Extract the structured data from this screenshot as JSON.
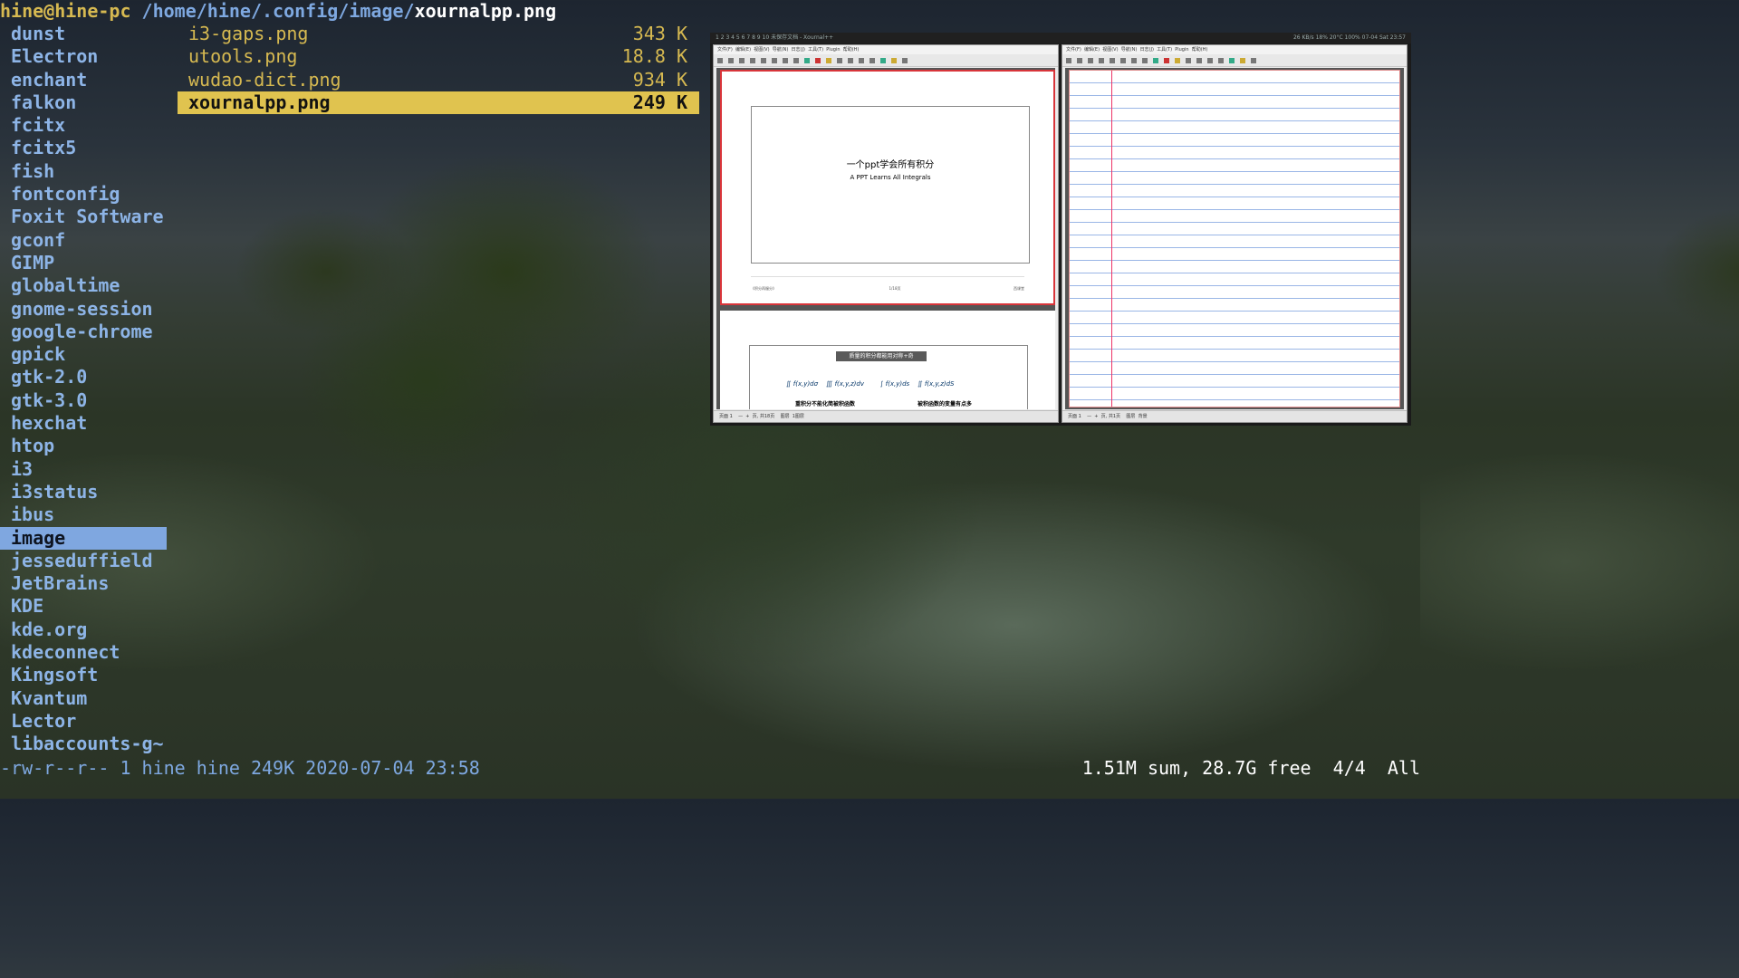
{
  "prompt": {
    "user": "hine@hine-pc",
    "path": "/home/hine/.config/image/",
    "file": "xournalpp.png"
  },
  "directories": [
    "dunst",
    "Electron",
    "enchant",
    "falkon",
    "fcitx",
    "fcitx5",
    "fish",
    "fontconfig",
    "Foxit Software",
    "gconf",
    "GIMP",
    "globaltime",
    "gnome-session",
    "google-chrome",
    "gpick",
    "gtk-2.0",
    "gtk-3.0",
    "hexchat",
    "htop",
    "i3",
    "i3status",
    "ibus",
    "image",
    "jesseduffield",
    "JetBrains",
    "KDE",
    "kde.org",
    "kdeconnect",
    "Kingsoft",
    "Kvantum",
    "Lector",
    "libaccounts-g~"
  ],
  "selected_directory": "image",
  "files": [
    {
      "name": "i3-gaps.png",
      "size": "343 K"
    },
    {
      "name": "utools.png",
      "size": "18.8 K"
    },
    {
      "name": "wudao-dict.png",
      "size": "934 K"
    },
    {
      "name": "xournalpp.png",
      "size": "249 K"
    }
  ],
  "selected_file": "xournalpp.png",
  "status": {
    "info": "-rw-r--r-- 1 hine hine 249K 2020-07-04 23:58",
    "summary": "1.51M sum, 28.7G free  4/4  All"
  },
  "preview": {
    "titlebar_left": "1 2 3 4 5 6 7 8 9 10  未保存文档 - Xournal++",
    "titlebar_right": "26 KB/s  18%  20°C  100%  07-04 Sat 23:57",
    "menu_left": "文件(F)  编辑(E)  视图(V)  导航(N)  日志(J)  工具(T)  Plugin  帮助(H)",
    "menu_right": "文件(F)  编辑(E)  视图(V)  导航(N)  日志(J)  工具(T)  Plugin  帮助(H)",
    "slide_title": "一个ppt学会所有积分",
    "slide_subtitle": "A PPT Learns All Integrals",
    "page_footer_left": "《积分再服分》",
    "page_footer_mid": "1/18页",
    "page_footer_right": "西课堂",
    "slide2_title": "质量的积分都能用对称+奇",
    "slide2_math": "∬ f(x,y)dσ    ∭ f(x,y,z)dv        ∫ f(x,y)ds    ∬ f(x,y,z)dS",
    "slide2_a": "重积分不能化简被积函数",
    "slide2_b": "被积函数的变量有点多",
    "status_left": "页面 1    —  +  页, 共18页    图层  1图层",
    "status_right": "页面 1    —  +  页, 共1页    图层  背景"
  },
  "colors": {
    "dir": "#8db4e6",
    "dir_selected_bg": "#7fa7e0",
    "file": "#d6b951",
    "file_selected_bg": "#e0c34f"
  }
}
